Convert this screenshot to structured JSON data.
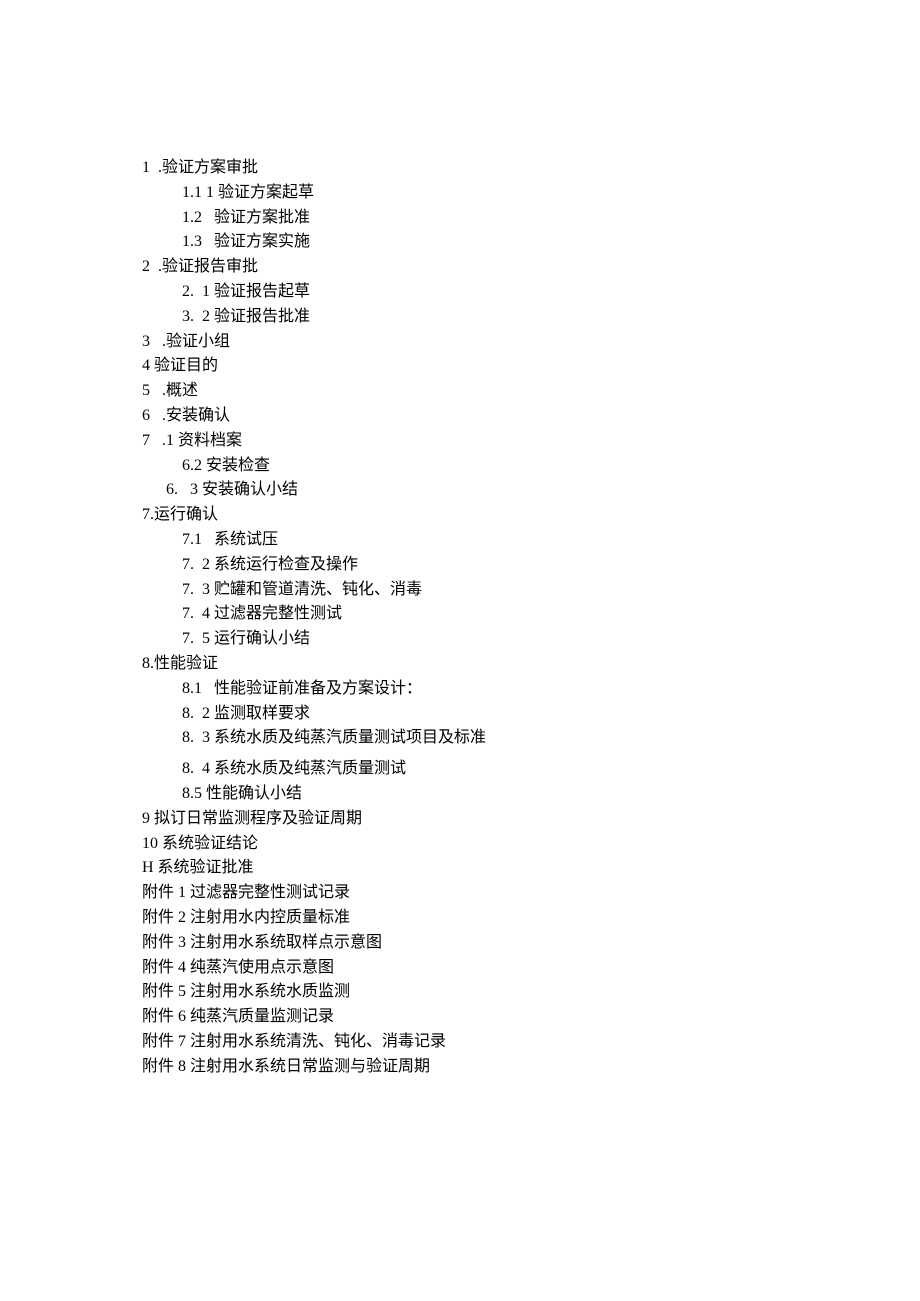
{
  "lines": [
    {
      "cls": "indent0",
      "text": "1  .验证方案审批"
    },
    {
      "cls": "indent1",
      "text": "1.1 1 验证方案起草"
    },
    {
      "cls": "indent1",
      "text": "1.2   验证方案批准"
    },
    {
      "cls": "indent1",
      "text": "1.3   验证方案实施"
    },
    {
      "cls": "indent0",
      "text": "2  .验证报告审批"
    },
    {
      "cls": "indent1",
      "text": "2.  1 验证报告起草"
    },
    {
      "cls": "indent1",
      "text": "3.  2 验证报告批准"
    },
    {
      "cls": "indent0",
      "text": "3   .验证小组"
    },
    {
      "cls": "indent0",
      "text": "4 验证目的"
    },
    {
      "cls": "indent0",
      "text": "5   .概述"
    },
    {
      "cls": "indent0",
      "text": "6   .安装确认"
    },
    {
      "cls": "indent0",
      "text": "7   .1 资料档案"
    },
    {
      "cls": "indent1",
      "text": "6.2 安装检查"
    },
    {
      "cls": "indent1b",
      "text": "6.   3 安装确认小结"
    },
    {
      "cls": "indent0",
      "text": "7.运行确认"
    },
    {
      "cls": "indent1",
      "text": "7.1   系统试压"
    },
    {
      "cls": "indent1",
      "text": "7.  2 系统运行检查及操作"
    },
    {
      "cls": "indent1",
      "text": "7.  3 贮罐和管道清洗、钝化、消毒"
    },
    {
      "cls": "indent1",
      "text": "7.  4 过滤器完整性测试"
    },
    {
      "cls": "indent1",
      "text": "7.  5 运行确认小结"
    },
    {
      "cls": "indent0",
      "text": "8.性能验证"
    },
    {
      "cls": "indent1",
      "text": "8.1   性能验证前准备及方案设计："
    },
    {
      "cls": "indent1",
      "text": "8.  2 监测取样要求"
    },
    {
      "cls": "indent1",
      "text": "8.  3 系统水质及纯蒸汽质量测试项目及标准"
    },
    {
      "cls": "spacer",
      "text": ""
    },
    {
      "cls": "indent1",
      "text": "8.  4 系统水质及纯蒸汽质量测试"
    },
    {
      "cls": "indent1",
      "text": "8.5 性能确认小结"
    },
    {
      "cls": "indent0",
      "text": "9 拟订日常监测程序及验证周期"
    },
    {
      "cls": "indent0",
      "text": "10 系统验证结论"
    },
    {
      "cls": "indent0",
      "text": "H 系统验证批准"
    },
    {
      "cls": "indent0",
      "text": "附件 1 过滤器完整性测试记录"
    },
    {
      "cls": "indent0",
      "text": "附件 2 注射用水内控质量标准"
    },
    {
      "cls": "indent0",
      "text": "附件 3 注射用水系统取样点示意图"
    },
    {
      "cls": "indent0",
      "text": "附件 4 纯蒸汽使用点示意图"
    },
    {
      "cls": "indent0",
      "text": "附件 5 注射用水系统水质监测"
    },
    {
      "cls": "indent0",
      "text": "附件 6 纯蒸汽质量监测记录"
    },
    {
      "cls": "indent0",
      "text": "附件 7 注射用水系统清洗、钝化、消毒记录"
    },
    {
      "cls": "indent0",
      "text": "附件 8 注射用水系统日常监测与验证周期"
    }
  ]
}
